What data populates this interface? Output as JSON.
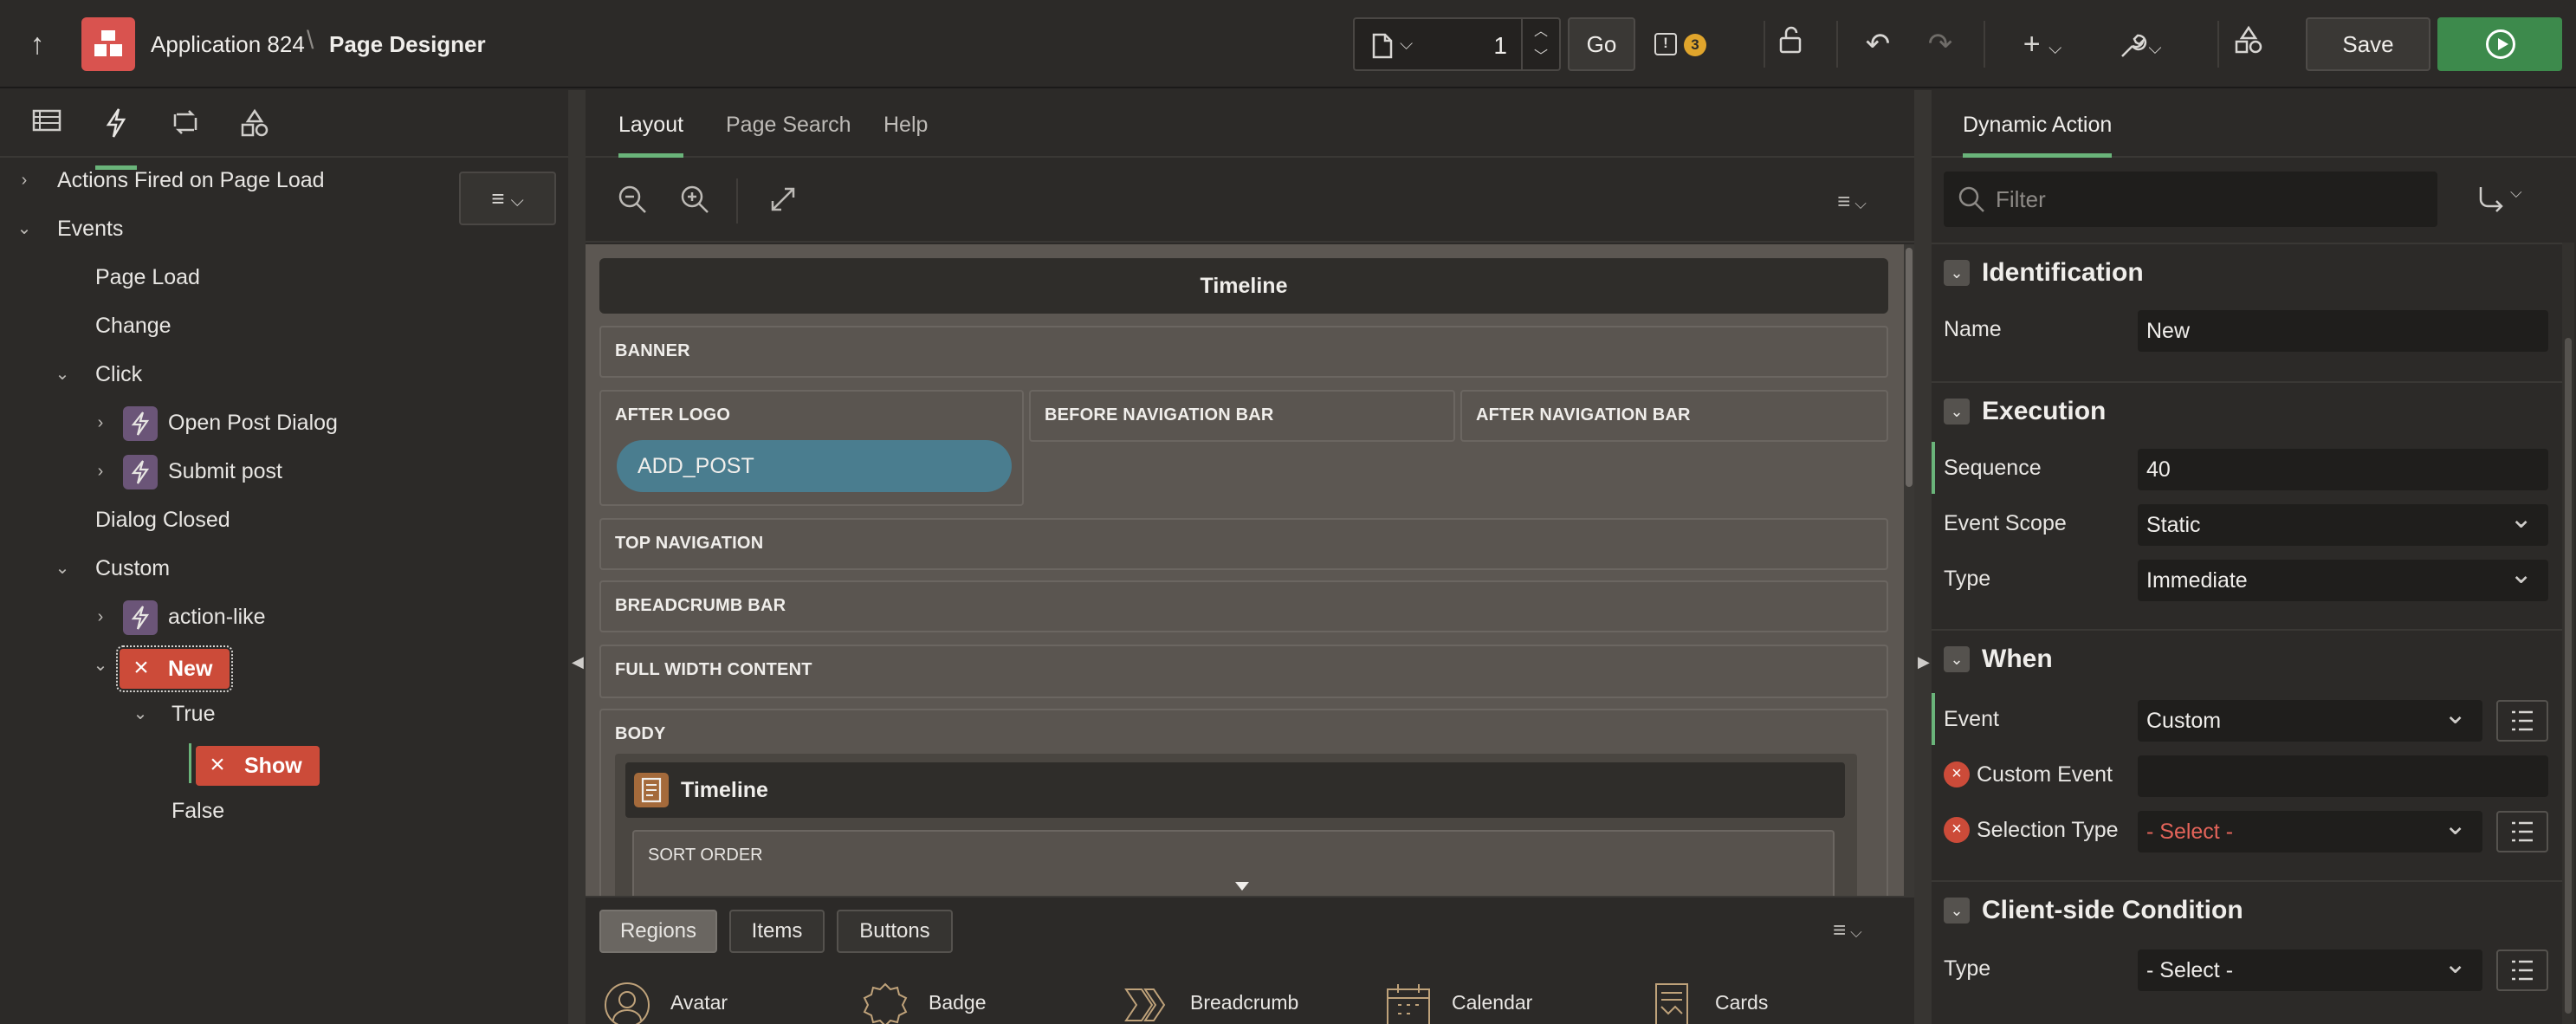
{
  "header": {
    "app_name": "Application 824",
    "separator": "\\",
    "page_title": "Page Designer",
    "page_number": "1",
    "go_label": "Go",
    "alert_count": "3",
    "save_label": "Save"
  },
  "left": {
    "tree": {
      "actions_on_load": "Actions Fired on Page Load",
      "events": "Events",
      "page_load": "Page Load",
      "change": "Change",
      "click": "Click",
      "open_post_dialog": "Open Post Dialog",
      "submit_post": "Submit post",
      "dialog_closed": "Dialog Closed",
      "custom": "Custom",
      "action_like": "action-like",
      "new": "New",
      "true_branch": "True",
      "show": "Show",
      "false_branch": "False"
    }
  },
  "center": {
    "tabs": [
      "Layout",
      "Page Search",
      "Help"
    ],
    "page_header": "Timeline",
    "slots": {
      "banner": "BANNER",
      "after_logo": "AFTER LOGO",
      "before_nav": "BEFORE NAVIGATION BAR",
      "after_nav": "AFTER NAVIGATION BAR",
      "top_nav": "TOP NAVIGATION",
      "breadcrumb": "BREADCRUMB BAR",
      "full_width": "FULL WIDTH CONTENT",
      "body": "BODY"
    },
    "add_post_item": "ADD_POST",
    "region_title": "Timeline",
    "sort_order": "SORT ORDER",
    "gallery_tabs": [
      "Regions",
      "Items",
      "Buttons"
    ],
    "gallery_items": [
      "Avatar",
      "Badge",
      "Breadcrumb",
      "Calendar",
      "Cards"
    ]
  },
  "right": {
    "tab": "Dynamic Action",
    "filter_placeholder": "Filter",
    "groups": {
      "identification": "Identification",
      "execution": "Execution",
      "when": "When",
      "client_condition": "Client-side Condition"
    },
    "props": {
      "name_label": "Name",
      "name_value": "New",
      "sequence_label": "Sequence",
      "sequence_value": "40",
      "scope_label": "Event Scope",
      "scope_value": "Static",
      "type_label": "Type",
      "type_value": "Immediate",
      "event_label": "Event",
      "event_value": "Custom",
      "custom_event_label": "Custom Event",
      "custom_event_value": "",
      "selection_type_label": "Selection Type",
      "selection_type_value": "- Select -",
      "cond_type_label": "Type",
      "cond_type_value": "- Select -"
    }
  },
  "colors": {
    "accent_green": "#6ab47a",
    "run_button": "#3d8a4c",
    "error_red": "#cc4b39",
    "alert_badge": "#e0a52c",
    "item_pill": "#4a7d8f"
  }
}
